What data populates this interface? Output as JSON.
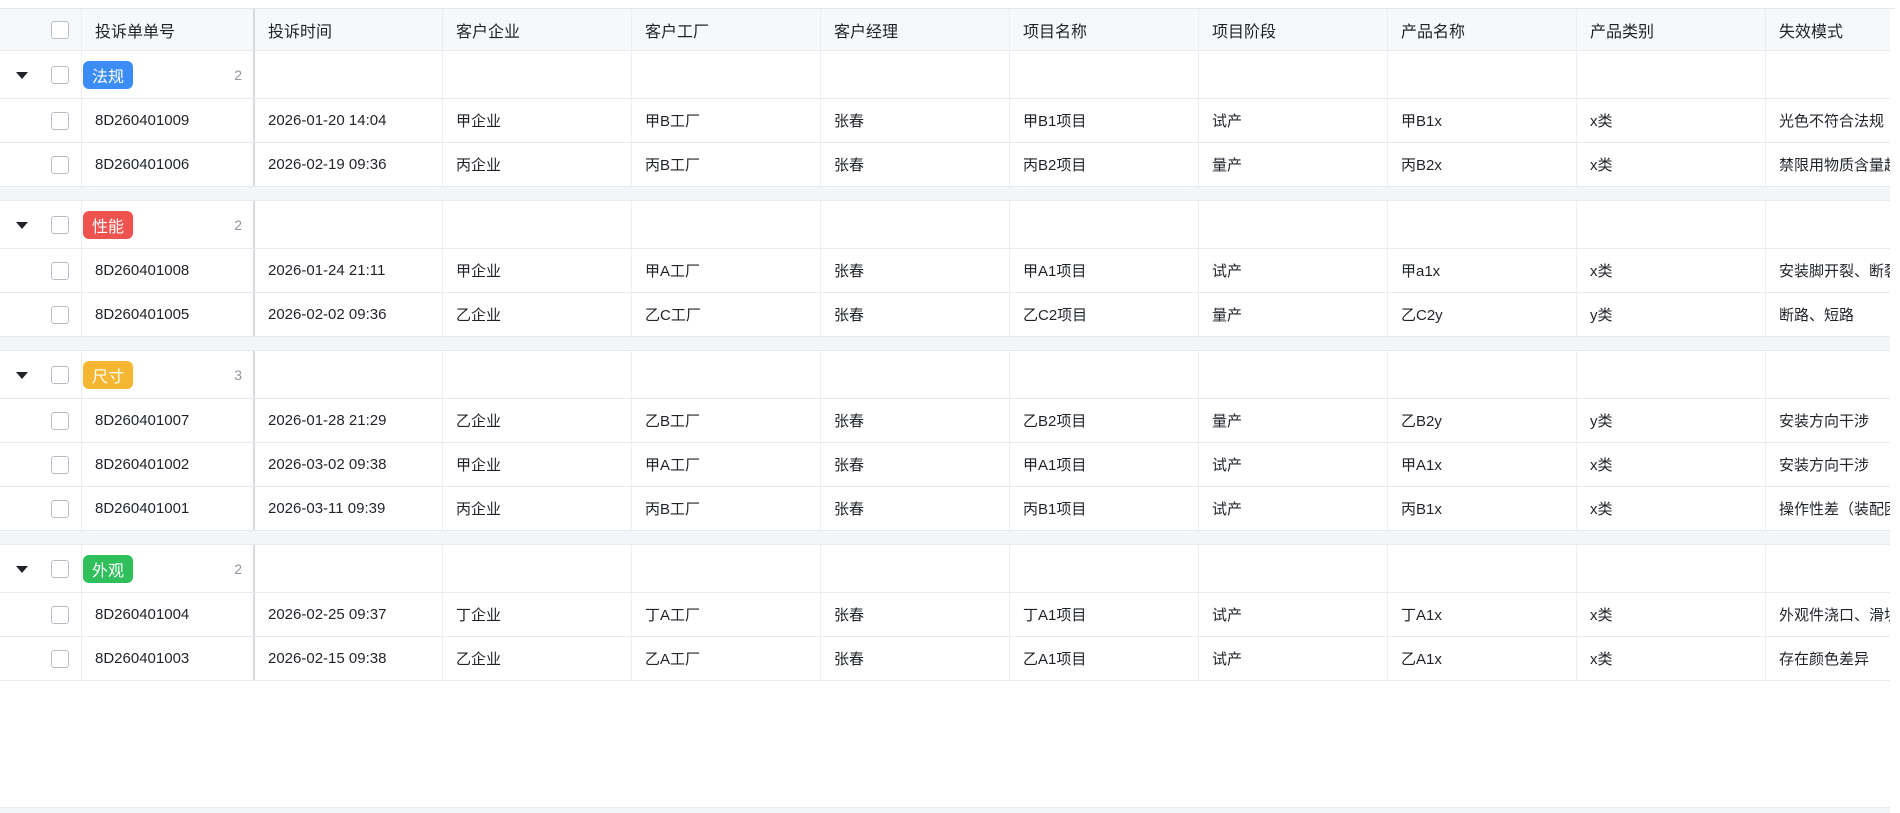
{
  "columns": [
    "投诉单单号",
    "投诉时间",
    "客户企业",
    "客户工厂",
    "客户经理",
    "项目名称",
    "项目阶段",
    "产品名称",
    "产品类别",
    "失效模式"
  ],
  "groups": [
    {
      "label": "法规",
      "color": "#3b8cf5",
      "count": "2",
      "rows": [
        {
          "no": "8D260401009",
          "time": "2026-01-20 14:04",
          "company": "甲企业",
          "factory": "甲B工厂",
          "manager": "张春",
          "project": "甲B1项目",
          "stage": "试产",
          "product": "甲B1x",
          "category": "x类",
          "failure": "光色不符合法规"
        },
        {
          "no": "8D260401006",
          "time": "2026-02-19 09:36",
          "company": "丙企业",
          "factory": "丙B工厂",
          "manager": "张春",
          "project": "丙B2项目",
          "stage": "量产",
          "product": "丙B2x",
          "category": "x类",
          "failure": "禁限用物质含量超标"
        }
      ]
    },
    {
      "label": "性能",
      "color": "#ef5350",
      "count": "2",
      "rows": [
        {
          "no": "8D260401008",
          "time": "2026-01-24 21:11",
          "company": "甲企业",
          "factory": "甲A工厂",
          "manager": "张春",
          "project": "甲A1项目",
          "stage": "试产",
          "product": "甲a1x",
          "category": "x类",
          "failure": "安装脚开裂、断裂"
        },
        {
          "no": "8D260401005",
          "time": "2026-02-02 09:36",
          "company": "乙企业",
          "factory": "乙C工厂",
          "manager": "张春",
          "project": "乙C2项目",
          "stage": "量产",
          "product": "乙C2y",
          "category": "y类",
          "failure": "断路、短路"
        }
      ]
    },
    {
      "label": "尺寸",
      "color": "#f5b731",
      "count": "3",
      "rows": [
        {
          "no": "8D260401007",
          "time": "2026-01-28 21:29",
          "company": "乙企业",
          "factory": "乙B工厂",
          "manager": "张春",
          "project": "乙B2项目",
          "stage": "量产",
          "product": "乙B2y",
          "category": "y类",
          "failure": "安装方向干涉"
        },
        {
          "no": "8D260401002",
          "time": "2026-03-02 09:38",
          "company": "甲企业",
          "factory": "甲A工厂",
          "manager": "张春",
          "project": "甲A1项目",
          "stage": "试产",
          "product": "甲A1x",
          "category": "x类",
          "failure": "安装方向干涉"
        },
        {
          "no": "8D260401001",
          "time": "2026-03-11 09:39",
          "company": "丙企业",
          "factory": "丙B工厂",
          "manager": "张春",
          "project": "丙B1项目",
          "stage": "试产",
          "product": "丙B1x",
          "category": "x类",
          "failure": "操作性差（装配困难）"
        }
      ]
    },
    {
      "label": "外观",
      "color": "#2fbf5b",
      "count": "2",
      "rows": [
        {
          "no": "8D260401004",
          "time": "2026-02-25 09:37",
          "company": "丁企业",
          "factory": "丁A工厂",
          "manager": "张春",
          "project": "丁A1项目",
          "stage": "试产",
          "product": "丁A1x",
          "category": "x类",
          "failure": "外观件浇口、滑块"
        },
        {
          "no": "8D260401003",
          "time": "2026-02-15 09:38",
          "company": "乙企业",
          "factory": "乙A工厂",
          "manager": "张春",
          "project": "乙A1项目",
          "stage": "试产",
          "product": "乙A1x",
          "category": "x类",
          "failure": "存在颜色差异"
        }
      ]
    }
  ]
}
